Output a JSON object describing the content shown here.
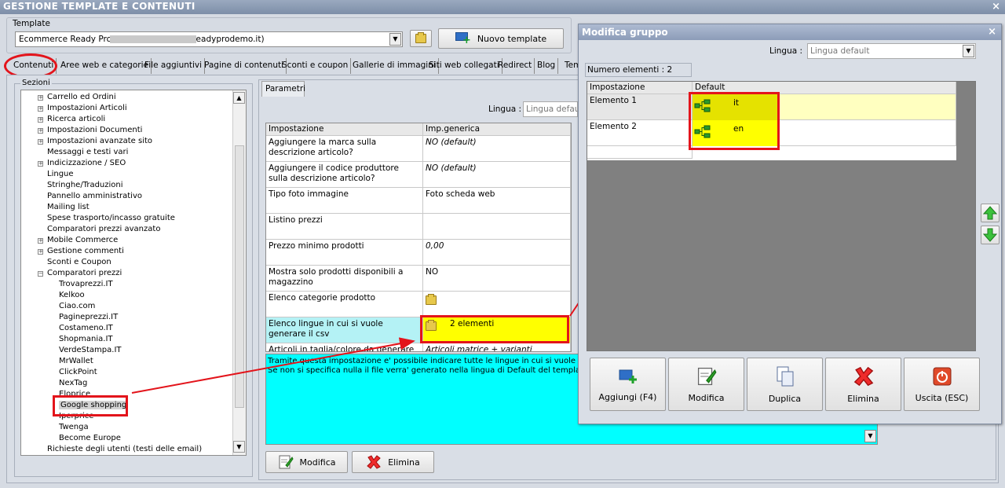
{
  "window": {
    "title": "GESTIONE TEMPLATE E CONTENUTI",
    "close": "×"
  },
  "template": {
    "label": "Template",
    "selected": "Ecommerce Ready Pro                              .readyprodemo.it)",
    "new_button": "Nuovo template"
  },
  "tabs": [
    "Contenuti",
    "Aree web e categorie",
    "File aggiuntivi",
    "Pagine di contenuti",
    "Sconti e coupon",
    "Gallerie di immagini",
    "Siti web collegati",
    "Redirect",
    "Blog",
    "Tem"
  ],
  "sections": {
    "label": "Sezioni",
    "items": [
      {
        "text": "Carrello ed Ordini",
        "expandable": true,
        "level": 0
      },
      {
        "text": "Impostazioni Articoli",
        "expandable": true,
        "level": 0
      },
      {
        "text": "Ricerca articoli",
        "expandable": true,
        "level": 0
      },
      {
        "text": "Impostazioni Documenti",
        "expandable": true,
        "level": 0
      },
      {
        "text": "Impostazioni avanzate sito",
        "expandable": true,
        "level": 0
      },
      {
        "text": "Messaggi e testi vari",
        "expandable": false,
        "level": 0
      },
      {
        "text": "Indicizzazione / SEO",
        "expandable": true,
        "level": 0
      },
      {
        "text": "Lingue",
        "expandable": false,
        "level": 0
      },
      {
        "text": "Stringhe/Traduzioni",
        "expandable": false,
        "level": 0
      },
      {
        "text": "Pannello amministrativo",
        "expandable": false,
        "level": 0
      },
      {
        "text": "Mailing list",
        "expandable": false,
        "level": 0
      },
      {
        "text": "Spese trasporto/incasso gratuite",
        "expandable": false,
        "level": 0
      },
      {
        "text": "Comparatori prezzi avanzato",
        "expandable": false,
        "level": 0
      },
      {
        "text": "Mobile Commerce",
        "expandable": true,
        "level": 0
      },
      {
        "text": "Gestione commenti",
        "expandable": true,
        "level": 0
      },
      {
        "text": "Sconti e Coupon",
        "expandable": false,
        "level": 0
      },
      {
        "text": "Comparatori prezzi",
        "expandable": "open",
        "level": 0
      },
      {
        "text": "Trovaprezzi.IT",
        "level": 1
      },
      {
        "text": "Kelkoo",
        "level": 1
      },
      {
        "text": "Ciao.com",
        "level": 1
      },
      {
        "text": "Pagineprezzi.IT",
        "level": 1
      },
      {
        "text": "Costameno.IT",
        "level": 1
      },
      {
        "text": "Shopmania.IT",
        "level": 1
      },
      {
        "text": "VerdeStampa.IT",
        "level": 1
      },
      {
        "text": "MrWallet",
        "level": 1
      },
      {
        "text": "ClickPoint",
        "level": 1
      },
      {
        "text": "NexTag",
        "level": 1
      },
      {
        "text": "Eloprice",
        "level": 1
      },
      {
        "text": "Google shopping",
        "level": 1,
        "selected": true
      },
      {
        "text": "Iperprice",
        "level": 1
      },
      {
        "text": "Twenga",
        "level": 1
      },
      {
        "text": "Become Europe",
        "level": 1
      },
      {
        "text": "Richieste degli utenti (testi delle email)",
        "expandable": false,
        "level": 0
      }
    ]
  },
  "params": {
    "tab": "Parametri",
    "lingua_label": "Lingua :",
    "lingua_value": "Lingua default",
    "col_setting": "Impostazione",
    "col_value": "Imp.generica",
    "rows": [
      {
        "setting": "Aggiungere la marca sulla descrizione articolo?",
        "value": "NO (default)",
        "italic": true
      },
      {
        "setting": "Aggiungere il codice produttore sulla descrizione articolo?",
        "value": "NO (default)",
        "italic": true
      },
      {
        "setting": "Tipo foto immagine",
        "value": "Foto scheda web",
        "italic": false
      },
      {
        "setting": "Listino prezzi",
        "value": "",
        "italic": false
      },
      {
        "setting": "Prezzo minimo prodotti",
        "value": "0,00",
        "italic": true
      },
      {
        "setting": "Mostra solo prodotti disponibili a magazzino",
        "value": "NO",
        "italic": false
      },
      {
        "setting": "Elenco categorie prodotto",
        "value": "",
        "italic": false
      },
      {
        "setting": "Elenco lingue in cui si vuole generare il csv",
        "value": "2 elementi",
        "italic": false
      },
      {
        "setting": "Articoli in taglia/colore da generare",
        "value": "Articoli matrice + varianti",
        "italic": true
      }
    ],
    "description": "Tramite questa impostazione e' possibile indicare tutte le lingue in cui si vuole rendere disp\nSe non si specifica nulla il file verra' generato nella lingua di Default del template.",
    "modify_button": "Modifica",
    "delete_button": "Elimina"
  },
  "dialog": {
    "title": "Modifica gruppo",
    "close": "×",
    "lingua_label": "Lingua :",
    "lingua_value": "Lingua default",
    "count_label": "Numero elementi : 2",
    "col_setting": "Impostazione",
    "col_default": "Default",
    "rows": [
      {
        "setting": "Elemento 1",
        "value": "it"
      },
      {
        "setting": "Elemento 2",
        "value": "en"
      }
    ],
    "buttons": {
      "add": "Aggiungi (F4)",
      "modify": "Modifica",
      "duplicate": "Duplica",
      "delete": "Elimina",
      "exit": "Uscita (ESC)"
    }
  },
  "colors": {
    "highlight_yellow": "#ffff00",
    "annotation_red": "#e3141b",
    "description_cyan": "#00ffff",
    "title_bar": "#8394ad",
    "dialog_title": "#9ba9c2"
  }
}
